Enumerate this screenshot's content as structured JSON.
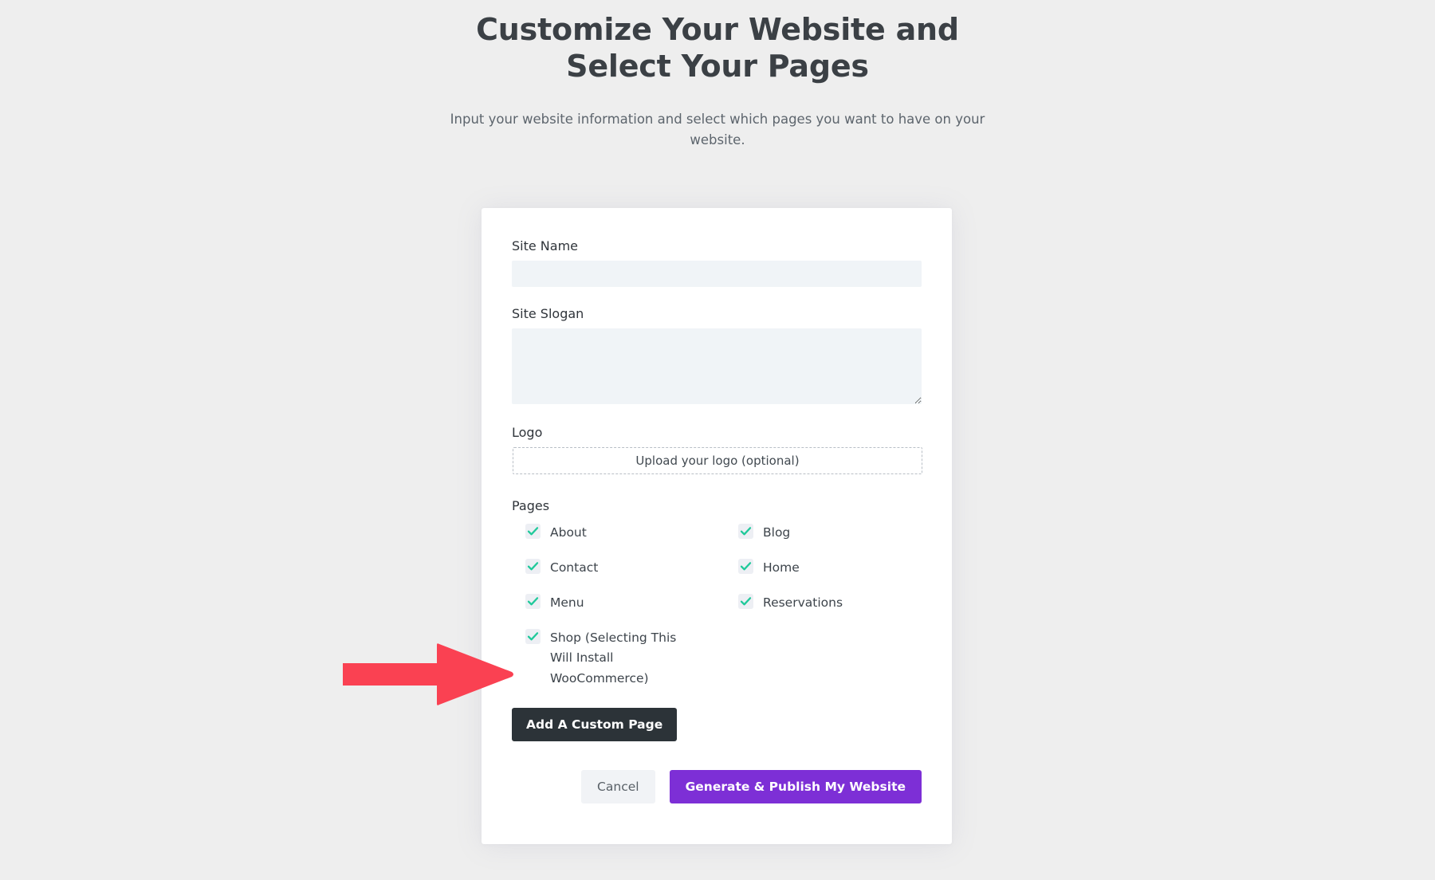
{
  "header": {
    "title": "Customize Your Website and Select Your Pages",
    "subtitle": "Input your website information and select which pages you want to have on your website."
  },
  "form": {
    "site_name": {
      "label": "Site Name",
      "value": "",
      "placeholder": ""
    },
    "site_slogan": {
      "label": "Site Slogan",
      "value": "",
      "placeholder": ""
    },
    "logo": {
      "label": "Logo",
      "upload_text": "Upload your logo (optional)"
    },
    "pages": {
      "label": "Pages",
      "items": [
        {
          "label": "About",
          "checked": true
        },
        {
          "label": "Blog",
          "checked": true
        },
        {
          "label": "Contact",
          "checked": true
        },
        {
          "label": "Home",
          "checked": true
        },
        {
          "label": "Menu",
          "checked": true
        },
        {
          "label": "Reservations",
          "checked": true
        },
        {
          "label": "Shop (Selecting This Will Install WooCommerce)",
          "checked": true
        }
      ]
    },
    "add_custom_page_label": "Add A Custom Page"
  },
  "actions": {
    "cancel_label": "Cancel",
    "generate_label": "Generate & Publish My Website"
  },
  "annotation": {
    "arrow_icon": "right-arrow-icon",
    "arrow_color": "#fa4152",
    "points_to": "Shop (Selecting This Will Install WooCommerce)"
  },
  "colors": {
    "page_background": "#eeeeee",
    "card_background": "#ffffff",
    "input_background": "#f0f4f7",
    "checkbox_background": "#edeff4",
    "checkmark": "#1fc99a",
    "primary_button": "#7d2fd6",
    "dark_button": "#2c3338",
    "cancel_button": "#f1f3f6",
    "title_text": "#3b4045",
    "body_text": "#5d656d",
    "annotation_red": "#fa4152"
  }
}
